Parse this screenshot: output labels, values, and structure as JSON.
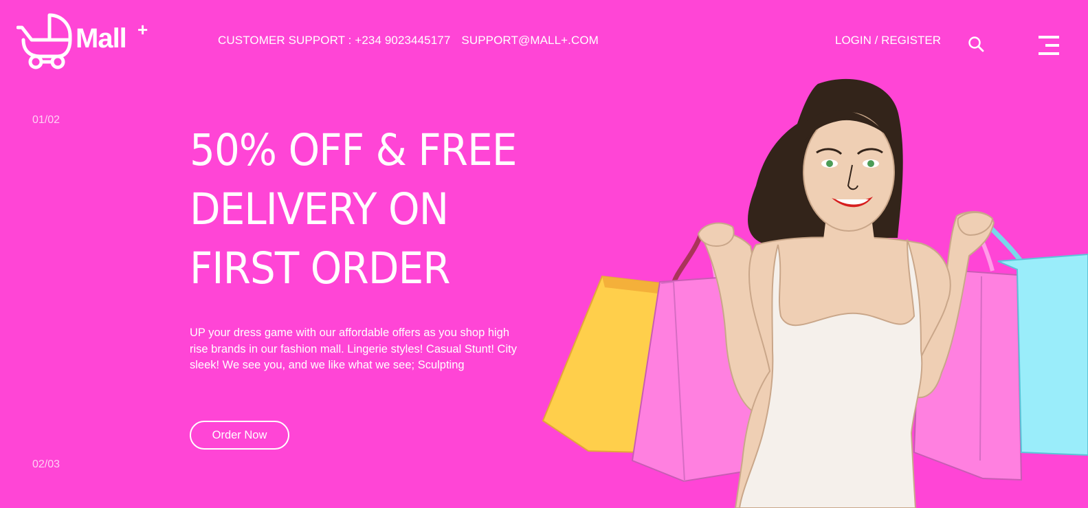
{
  "brand": {
    "name": "Mall",
    "superscript": "+"
  },
  "header": {
    "support_phone": "CUSTOMER SUPPORT : +234 9023445177",
    "support_email": "SUPPORT@MALL+.COM",
    "login_label": "LOGIN / REGISTER",
    "search_icon": "search-icon",
    "menu_icon": "menu-icon"
  },
  "slider": {
    "counter_top": "01/02",
    "counter_bottom": "02/03"
  },
  "hero": {
    "headline_lines": [
      "50% OFF & FREE",
      "DELIVERY ON",
      "FIRST ORDER"
    ],
    "description": "UP your dress game with our affordable offers as you shop high rise brands in our fashion mall. Lingerie styles! Casual Stunt! City sleek! We see you, and we like what we see; Sculpting",
    "cta_label": "Order Now"
  },
  "colors": {
    "background": "#FF45D6",
    "text": "#FFFFFF",
    "bag_yellow": "#FFCF4B",
    "bag_pink": "#FF80E0",
    "bag_blue": "#9AEDFA",
    "hair": "#33241A",
    "skin": "#EFCFB4",
    "top": "#F5F0EB"
  }
}
